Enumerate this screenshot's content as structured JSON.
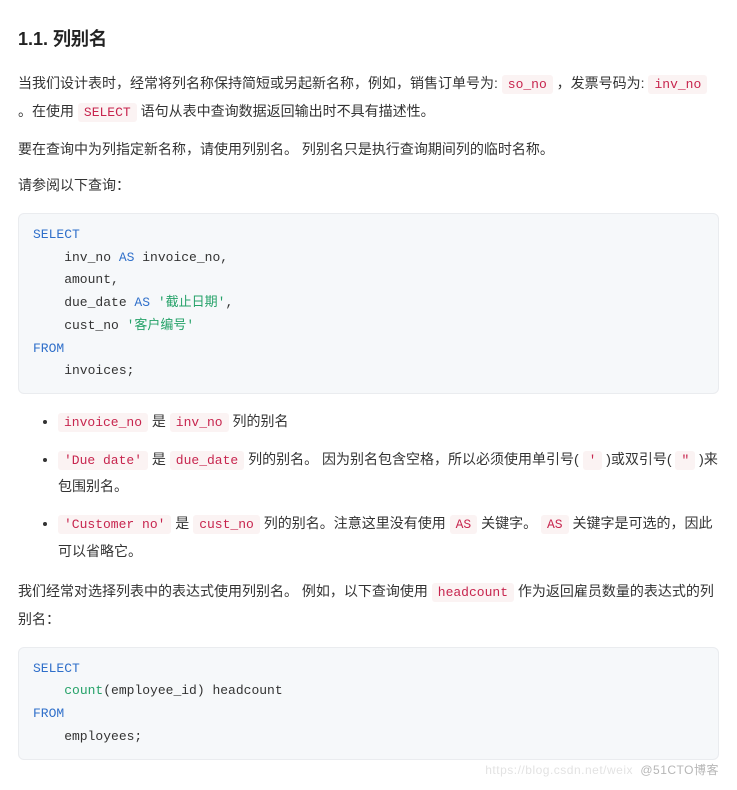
{
  "heading": "1.1. 列别名",
  "p1": {
    "part1": "当我们设计表时，经常将列名称保持简短或另起新名称，例如，销售订单号为: ",
    "code1": "so_no",
    "part2": " ，发票号码为: ",
    "code2": "inv_no",
    "part3": " 。在使用 ",
    "code3": "SELECT",
    "part4": " 语句从表中查询数据返回输出时不具有描述性。"
  },
  "p2": "要在查询中为列指定新名称，请使用列别名。 列别名只是执行查询期间列的临时名称。",
  "p3": "请参阅以下查询：",
  "code1": {
    "kw_select": "SELECT",
    "l1a": "    inv_no ",
    "l1kw": "AS",
    "l1b": " invoice_no,",
    "l2": "    amount,",
    "l3a": "    due_date ",
    "l3kw": "AS",
    "l3b": " ",
    "l3str": "'截止日期'",
    "l3c": ",",
    "l4a": "    cust_no ",
    "l4str": "'客户编号'",
    "kw_from": "FROM",
    "l5": "    invoices;"
  },
  "list": {
    "i1": {
      "c1": "invoice_no",
      "t1": " 是 ",
      "c2": "inv_no",
      "t2": " 列的别名"
    },
    "i2": {
      "c1": "'Due date'",
      "t1": " 是 ",
      "c2": "due_date",
      "t2": " 列的别名。 因为别名包含空格，所以必须使用单引号( ",
      "c3": "'",
      "t3": " )或双引号( ",
      "c4": "\"",
      "t4": " )来包围别名。"
    },
    "i3": {
      "c1": "'Customer no'",
      "t1": " 是 ",
      "c2": "cust_no",
      "t2": " 列的别名。注意这里没有使用 ",
      "c3": "AS",
      "t3": " 关键字。 ",
      "c4": "AS",
      "t4": " 关键字是可选的，因此可以省略它。"
    }
  },
  "p4": {
    "part1": "我们经常对选择列表中的表达式使用列别名。 例如，以下查询使用 ",
    "code1": "headcount",
    "part2": " 作为返回雇员数量的表达式的列别名："
  },
  "code2": {
    "kw_select": "SELECT",
    "l1a": "    ",
    "l1fn": "count",
    "l1b": "(employee_id) headcount",
    "kw_from": "FROM",
    "l2": "    employees;"
  },
  "watermark": "@51CTO博客",
  "watermark2": "https://blog.csdn.net/weix"
}
